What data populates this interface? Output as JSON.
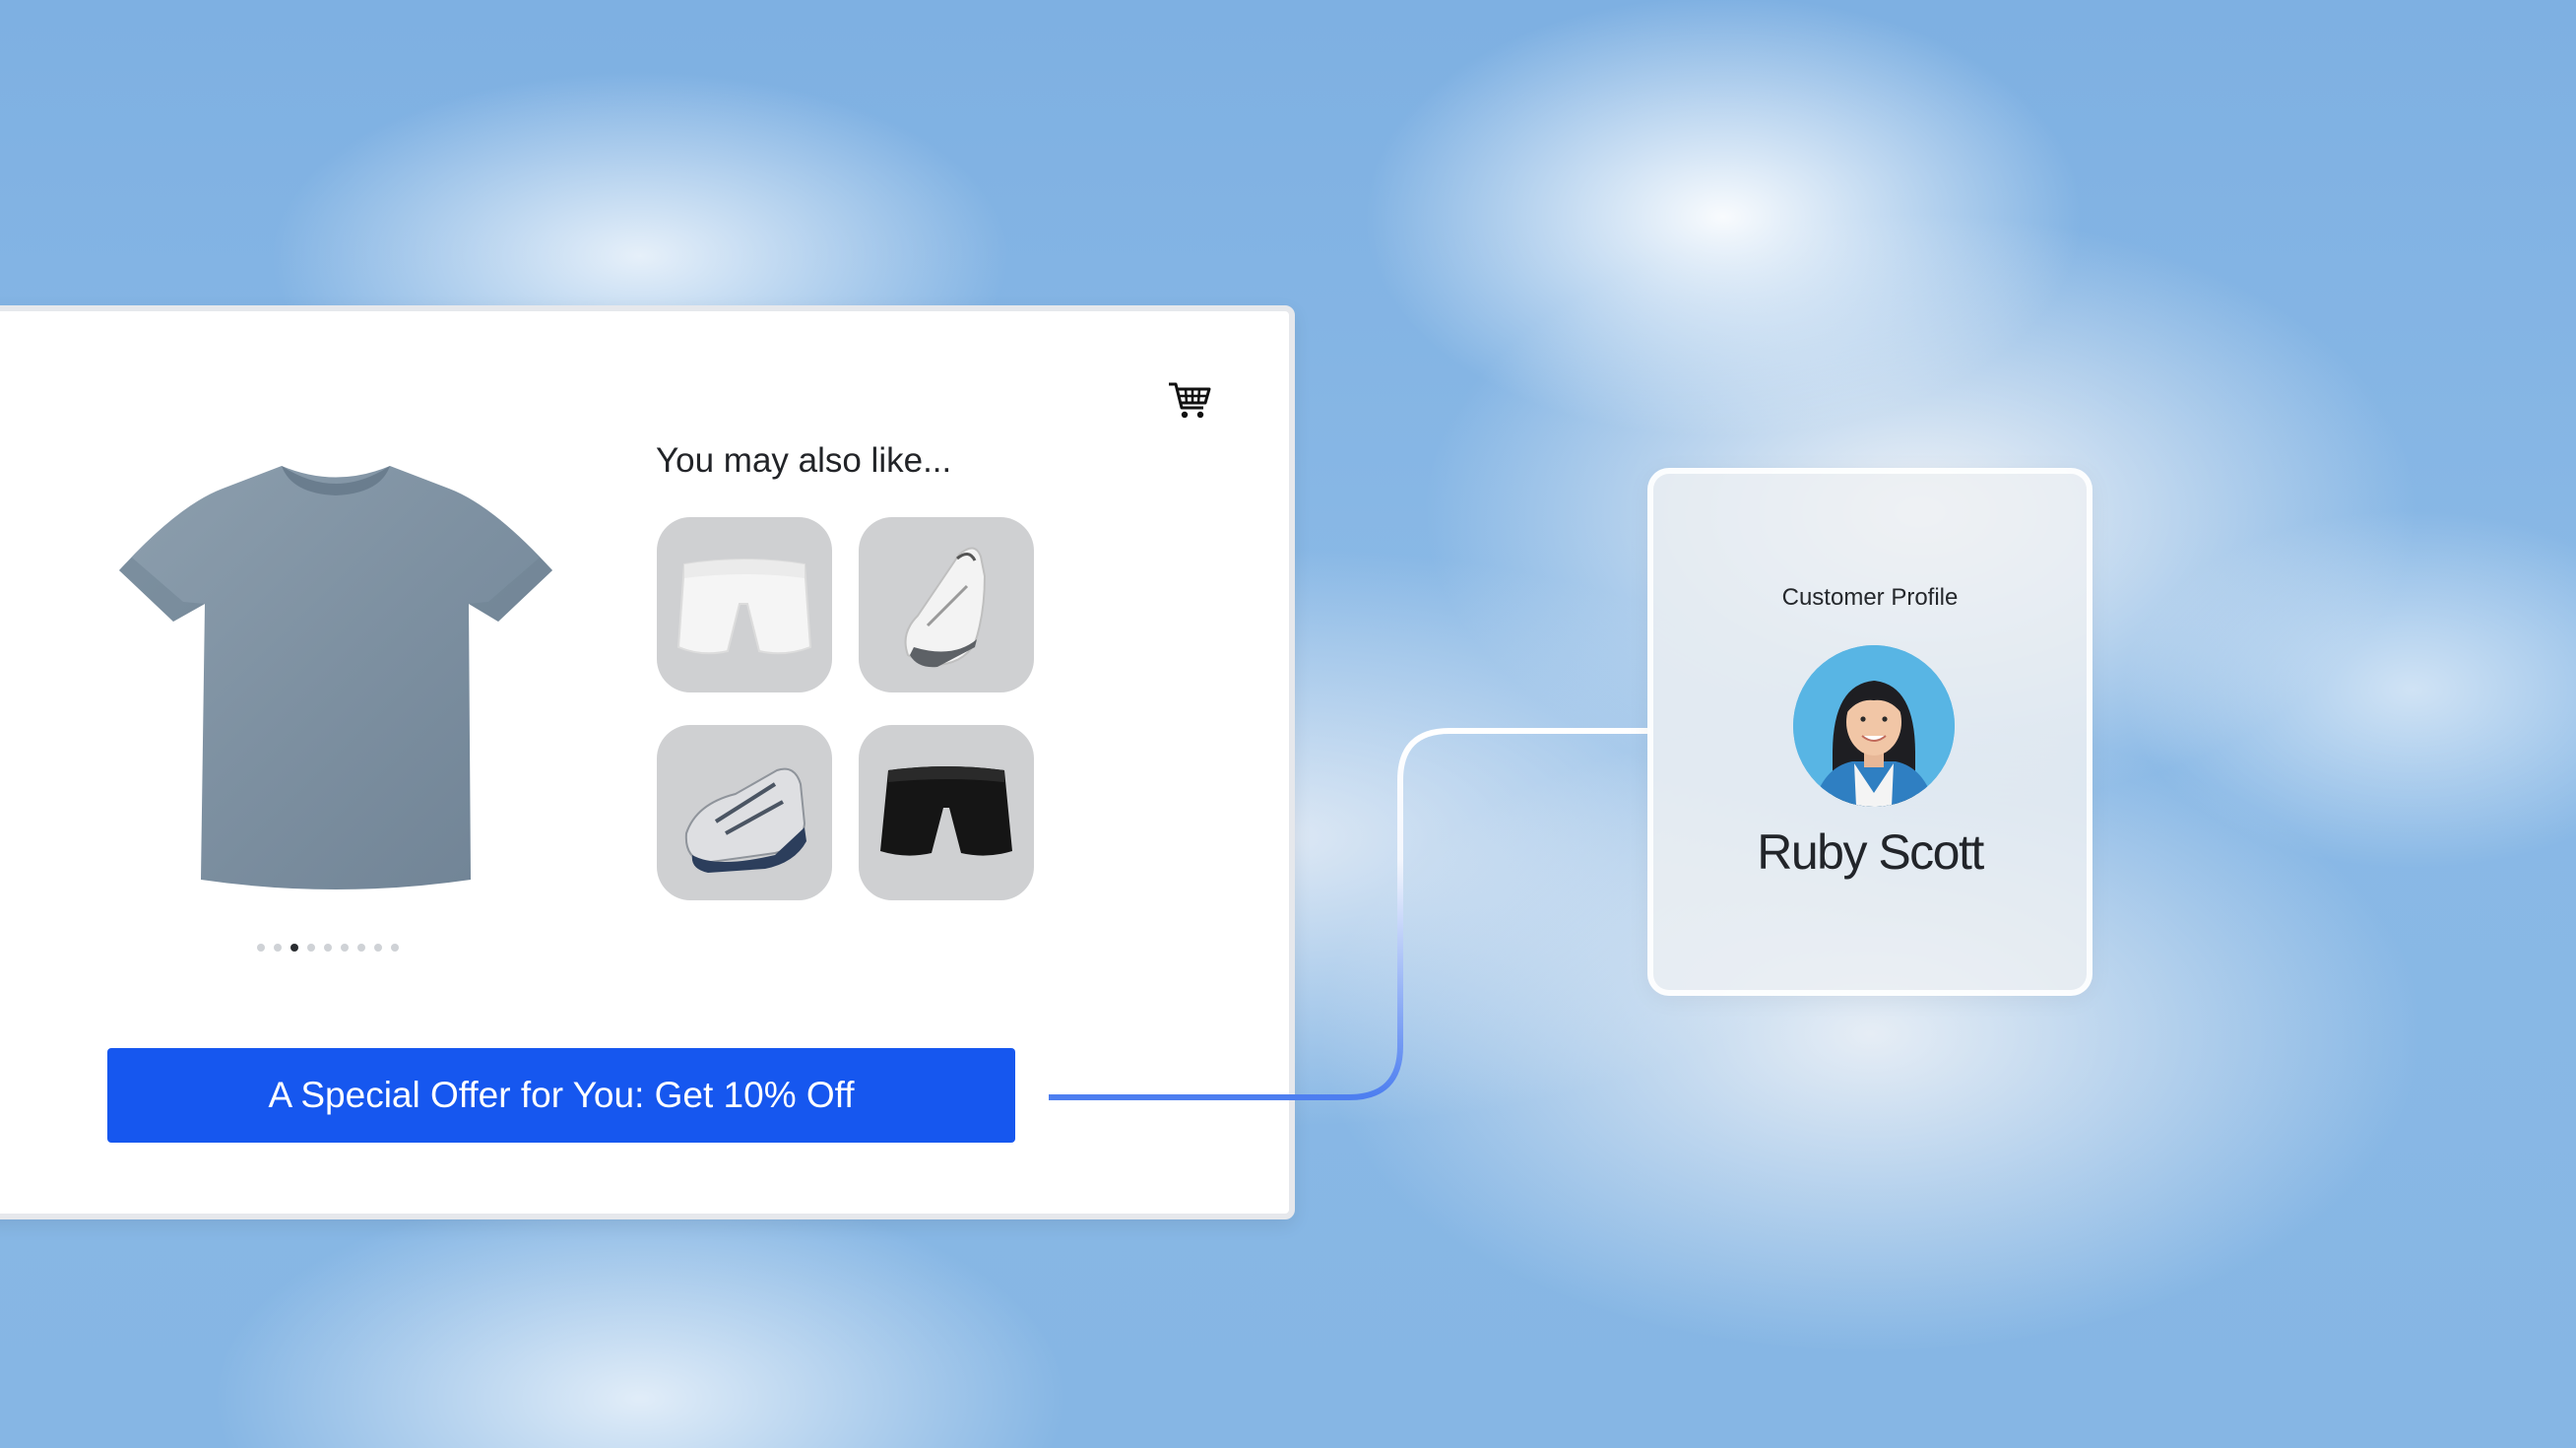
{
  "product_panel": {
    "section_title": "You may also like...",
    "offer_label": "A Special Offer for You: Get 10% Off",
    "carousel": {
      "total": 9,
      "active_index": 2
    },
    "main_product_icon": "gray-tshirt-image",
    "recommendations": [
      {
        "icon": "white-shorts-image"
      },
      {
        "icon": "white-sneaker-image"
      },
      {
        "icon": "gray-navy-sneaker-image"
      },
      {
        "icon": "black-shorts-image"
      }
    ],
    "cart_icon": "shopping-cart-icon"
  },
  "profile": {
    "heading": "Customer Profile",
    "name": "Ruby Scott",
    "avatar_icon": "customer-avatar-photo"
  },
  "colors": {
    "accent_blue": "#1657ef",
    "connector_light": "#ffffff",
    "connector_blue": "#4f7ff0",
    "tile_gray": "#cfd0d2"
  }
}
